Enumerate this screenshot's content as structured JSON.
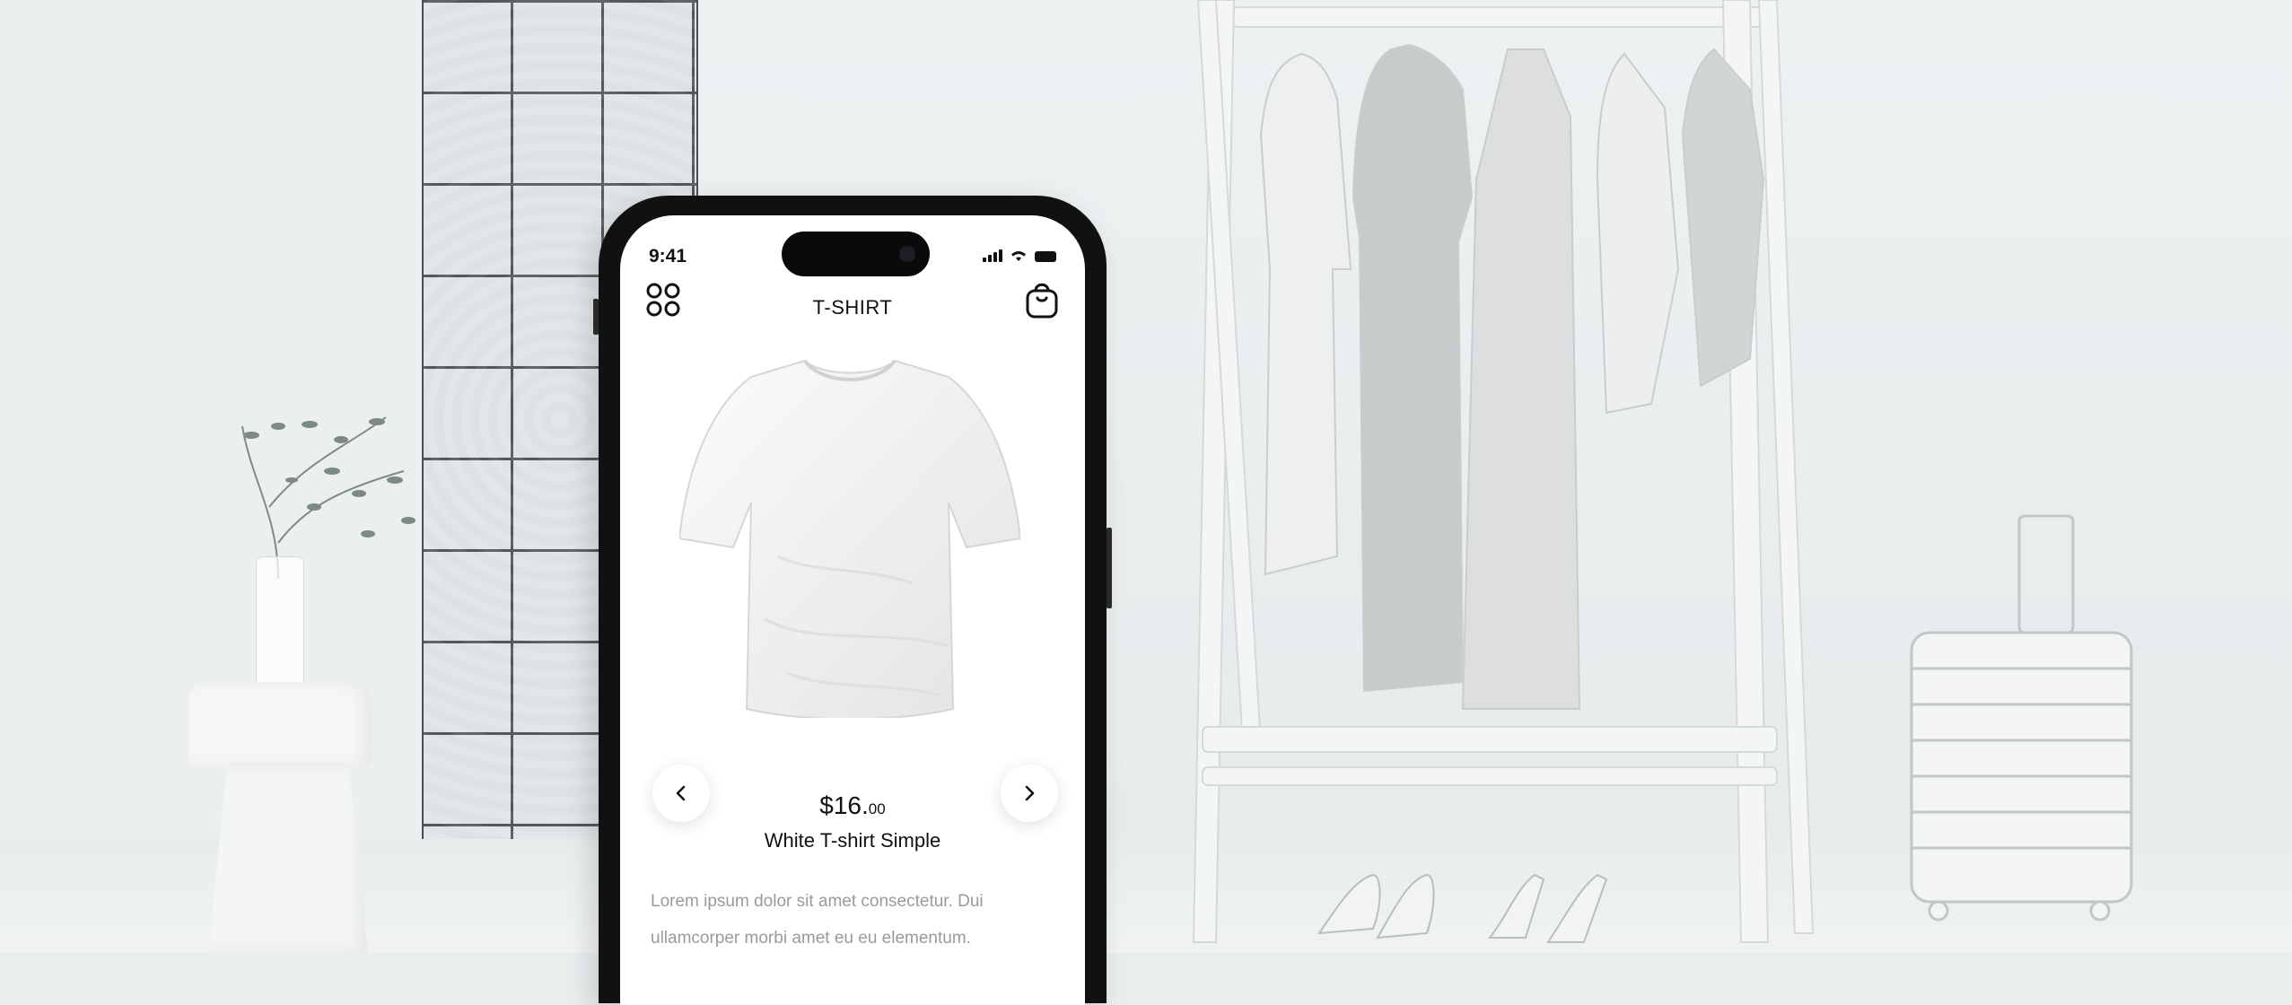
{
  "status_bar": {
    "time": "9:41"
  },
  "header": {
    "title": "T-SHIRT"
  },
  "product": {
    "price_main": "$16.",
    "price_cents": "00",
    "name": "White T-shirt Simple",
    "description": "Lorem ipsum dolor sit amet consectetur. Dui ullamcorper morbi amet eu eu elementum."
  },
  "icons": {
    "menu": "grid-icon",
    "cart": "shopping-bag-icon",
    "prev": "chevron-left-icon",
    "next": "chevron-right-icon"
  },
  "colors": {
    "background": "#e9edee",
    "screen": "#ffffff",
    "text": "#111111",
    "muted": "#9a9a9a",
    "phone_frame": "#111111"
  }
}
